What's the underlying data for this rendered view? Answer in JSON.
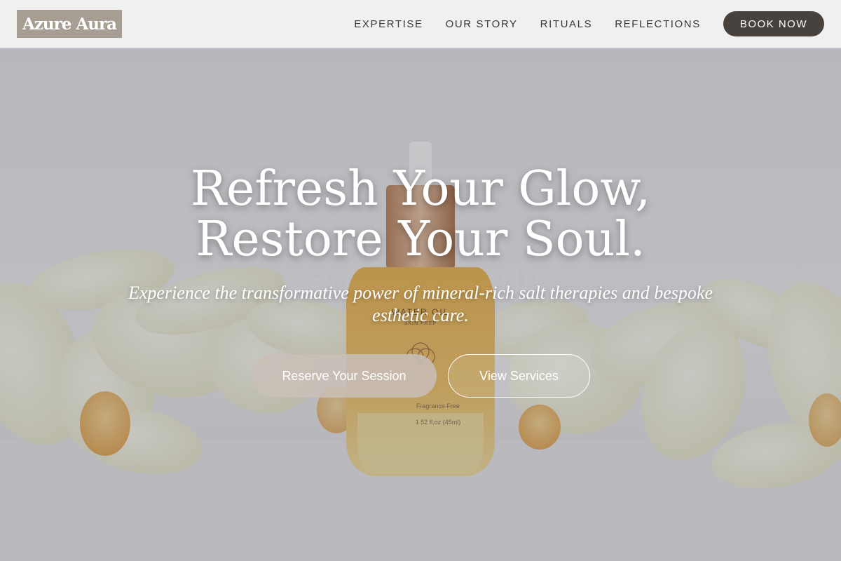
{
  "brand": {
    "name": "Azure Aura"
  },
  "nav": {
    "links": [
      "EXPERTISE",
      "OUR STORY",
      "RITUALS",
      "REFLECTIONS"
    ],
    "cta_label": "BOOK NOW"
  },
  "hero": {
    "headline_line1": "Refresh Your Glow,",
    "headline_line2": "Restore Your Soul.",
    "subheadline": "Experience the transformative power of mineral-rich salt therapies and bespoke esthetic care.",
    "primary_button": "Reserve Your Session",
    "secondary_button": "View Services",
    "product_label_line1": "WATER OIL",
    "product_label_line2": "SKIN PREP",
    "product_label_line3": "Fragrance Free",
    "product_label_line4": "1.52 fl.oz (45ml)",
    "watermark_text": "seaside beauty"
  },
  "colors": {
    "header_bg": "#f0f0f0",
    "logo_bg": "#a79e93",
    "cta_bg": "#48423f",
    "primary_button_bg": "#c8beb7",
    "nav_text": "#3b3836"
  }
}
